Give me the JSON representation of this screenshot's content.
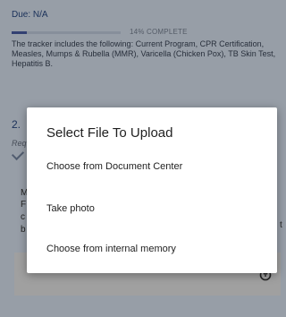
{
  "background": {
    "due_text": "Due: N/A",
    "progress": {
      "label": "14% COMPLETE",
      "percent": 14
    },
    "tracker_description": "The tracker includes the following: Current Program, CPR Certification, Measles, Mumps & Rubella (MMR), Varicella (Chicken Pox), TB Skin Test, Hepatitis B.",
    "item2_title_fragment": "2.",
    "item2_subtitle_fragment": "Req",
    "peek_chars": [
      "M",
      "F",
      "c",
      "b"
    ],
    "peek_right_char": "t"
  },
  "dialog": {
    "title": "Select File To Upload",
    "options": [
      {
        "label": "Choose from Document Center"
      },
      {
        "label": "Take photo"
      },
      {
        "label": "Choose from internal memory"
      }
    ]
  },
  "colors": {
    "page_bg": "#dfe9f6",
    "accent": "#2a4b86",
    "progress_fill": "#4a5fa8",
    "scrim": "rgba(0,0,0,0.32)",
    "dialog_bg": "#ffffff"
  },
  "icons": {
    "status": "check-icon",
    "upload": "upload-icon"
  }
}
